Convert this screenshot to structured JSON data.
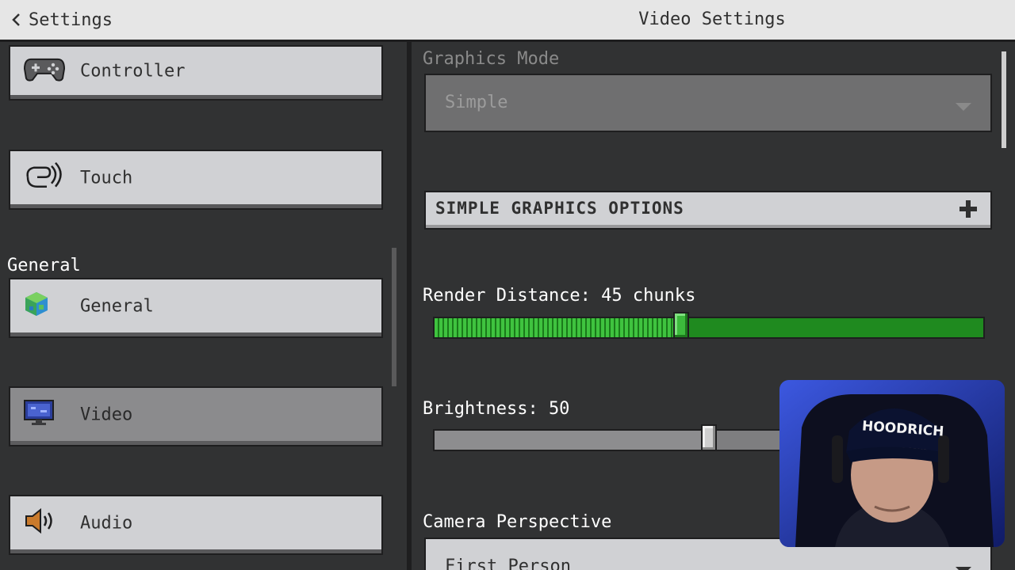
{
  "header": {
    "back_label": "Settings",
    "title": "Video Settings"
  },
  "sidebar": {
    "section_general": "General",
    "items": [
      {
        "label": "Controller",
        "icon": "controller-icon"
      },
      {
        "label": "Touch",
        "icon": "touch-icon"
      },
      {
        "label": "General",
        "icon": "globe-icon"
      },
      {
        "label": "Video",
        "icon": "monitor-icon",
        "selected": true
      },
      {
        "label": "Audio",
        "icon": "speaker-icon"
      }
    ]
  },
  "video": {
    "graphics_mode": {
      "label": "Graphics Mode",
      "value": "Simple"
    },
    "simple_graphics_header": "SIMPLE GRAPHICS OPTIONS",
    "render_distance": {
      "label": "Render Distance: 45 chunks",
      "fraction": 0.45
    },
    "brightness": {
      "label": "Brightness: 50",
      "fraction": 0.5
    },
    "camera_perspective": {
      "label": "Camera Perspective",
      "value": "First Person"
    }
  },
  "overlay": {
    "cap_text": "HOODRICH"
  },
  "colors": {
    "accent_green": "#3cba3c",
    "panel_bg": "#313233",
    "button_bg": "#d0d1d4"
  }
}
